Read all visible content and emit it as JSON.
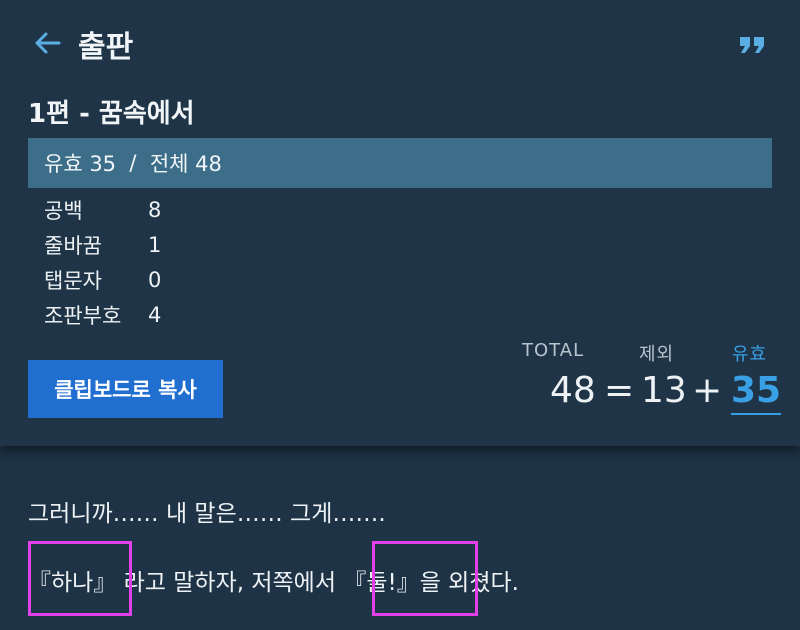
{
  "header": {
    "title": "출판",
    "back_icon": "arrow-left-icon",
    "quote_icon": "quote-icon"
  },
  "chapter": {
    "title": "1편 - 꿈속에서"
  },
  "summary": {
    "valid_label": "유효 35",
    "separator": "/",
    "total_label": "전체 48"
  },
  "stats": [
    {
      "label": "공백",
      "value": "8"
    },
    {
      "label": "줄바꿈",
      "value": "1"
    },
    {
      "label": "탭문자",
      "value": "0"
    },
    {
      "label": "조판부호",
      "value": "4"
    }
  ],
  "copy_button": {
    "label": "클립보드로 복사"
  },
  "totals": {
    "total_label": "TOTAL",
    "excluded_label": "제외",
    "valid_label": "유효",
    "total_value": "48",
    "equals": "=",
    "excluded_value": "13",
    "plus": "+",
    "valid_value": "35"
  },
  "text": {
    "line1": "그러니까…… 내 말은…… 그게…….",
    "line2": "『하나』 라고 말하자, 저쪽에서 『둘!』을 외쳤다."
  },
  "colors": {
    "background": "#1e3446",
    "summary_bar": "#3c6e8a",
    "accent": "#3aa0e6",
    "button": "#1f6ed0",
    "highlight": "#e33fe6"
  }
}
